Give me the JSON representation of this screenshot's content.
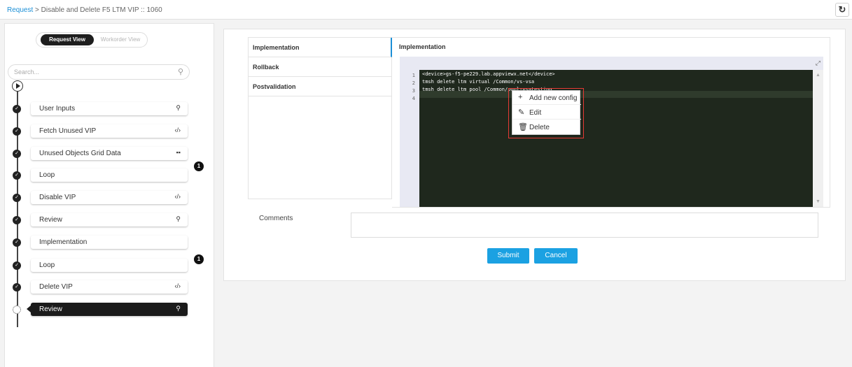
{
  "breadcrumb": {
    "root": "Request",
    "separator": ">",
    "current": "Disable and Delete F5 LTM VIP :: 1060"
  },
  "toolbar": {
    "refresh_icon": "refresh-icon"
  },
  "view_toggle": {
    "active": "Request View",
    "inactive": "Workorder View"
  },
  "search": {
    "placeholder": "Search..."
  },
  "steps": [
    {
      "label": "User Inputs",
      "icon": "user-icon",
      "glyph": "⚲"
    },
    {
      "label": "Fetch Unused VIP",
      "icon": "code-icon",
      "glyph": "‹/›"
    },
    {
      "label": "Unused Objects Grid Data",
      "icon": "grid-icon",
      "glyph": "▪▪"
    },
    {
      "label": "Loop",
      "icon": "",
      "glyph": ""
    },
    {
      "label": "Disable VIP",
      "icon": "code-icon",
      "glyph": "‹/›"
    },
    {
      "label": "Review",
      "icon": "user-icon",
      "glyph": "⚲"
    },
    {
      "label": "Implementation",
      "icon": "",
      "glyph": ""
    },
    {
      "label": "Loop",
      "icon": "",
      "glyph": ""
    },
    {
      "label": "Delete VIP",
      "icon": "code-icon",
      "glyph": "‹/›"
    },
    {
      "label": "Review",
      "icon": "user-icon",
      "glyph": "⚲",
      "active": true
    }
  ],
  "loop_badges": [
    "1",
    "1"
  ],
  "tabs": [
    "Implementation",
    "Rollback",
    "Postvalidation"
  ],
  "editor": {
    "title": "Implementation",
    "line_numbers": [
      "1",
      "2",
      "3",
      "4"
    ],
    "lines": [
      "<device>gs-f5-pe229.lab.appviewx.net</device>",
      "tmsh delete ltm virtual /Common/vs-vsa",
      "tmsh delete ltm pool /Common/pool-vsatesting",
      ""
    ]
  },
  "context_menu": [
    {
      "label": "Add new config",
      "icon": "plus-icon",
      "glyph": "+"
    },
    {
      "label": "Edit",
      "icon": "pencil-icon",
      "glyph": "✎"
    },
    {
      "label": "Delete",
      "icon": "trash-icon",
      "glyph": "🗑"
    }
  ],
  "comments": {
    "label": "Comments",
    "value": ""
  },
  "buttons": {
    "submit": "Submit",
    "cancel": "Cancel"
  },
  "colors": {
    "accent": "#1ba1e2",
    "link": "#1b8fd6",
    "editor_bg": "#1f281d",
    "highlight": "#e53935"
  }
}
